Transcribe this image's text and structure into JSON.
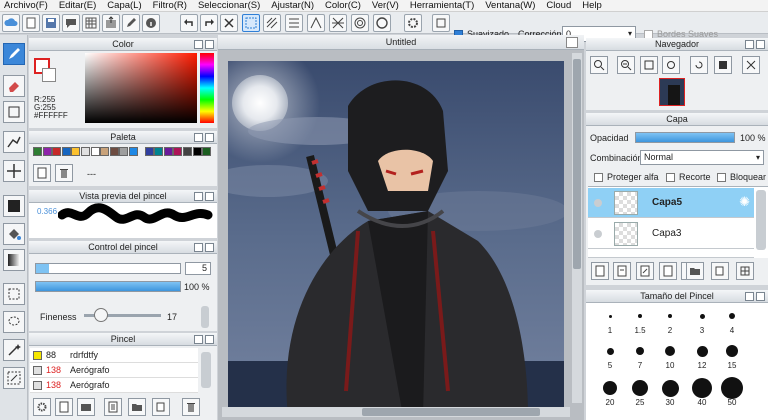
{
  "menu": [
    "Archivo(F)",
    "Editar(E)",
    "Capa(L)",
    "Filtro(R)",
    "Seleccionar(S)",
    "Ajustar(N)",
    "Color(C)",
    "Ver(V)",
    "Herramienta(T)",
    "Ventana(W)",
    "Cloud",
    "Help"
  ],
  "toolbar": {
    "suavizado_label": "Suavizado",
    "correccion_label": "Corrección",
    "correccion_value": "0",
    "bordes_label": "Bordes Suaves"
  },
  "color_panel": {
    "title": "Color",
    "r": "R:255",
    "g": "G:255",
    "hex": "#FFFFFF"
  },
  "palette_panel": {
    "title": "Paleta",
    "dashes": "---",
    "colors": [
      "#2e7d32",
      "#8e24aa",
      "#c62828",
      "#1565c0",
      "#fbc02d",
      "#e0e0e0",
      "#ffffff",
      "#c8a27a",
      "#6d4c41",
      "#9e9e9e",
      "#1e88e5",
      "#303f9f",
      "#00838f",
      "#6a1b9a",
      "#ad1457",
      "#424242",
      "#000000",
      "#1b5e20"
    ]
  },
  "brush_preview": {
    "title": "Vista previa del pincel",
    "size_value": "0.366"
  },
  "brush_control": {
    "title": "Control del pincel",
    "size": "5",
    "opacity": "100 %",
    "fineness_label": "Fineness",
    "fineness_value": "17"
  },
  "brush_list": {
    "title": "Pincel",
    "items": [
      {
        "size": "88",
        "name": "rdrfdtfy",
        "color": "#f5e600"
      },
      {
        "size": "138",
        "name": "Aerógrafo",
        "color": "#e0e0e0"
      },
      {
        "size": "138",
        "name": "Aerógrafo",
        "color": "#e0e0e0"
      }
    ]
  },
  "canvas": {
    "tab_title": "Untitled"
  },
  "navigator": {
    "title": "Navegador"
  },
  "layer_panel": {
    "title": "Capa",
    "opacity_label": "Opacidad",
    "opacity_value": "100 %",
    "blend_label": "Combinación",
    "blend_value": "Normal",
    "protect_label": "Proteger alfa",
    "clip_label": "Recorte",
    "lock_label": "Bloquear",
    "layers": [
      {
        "name": "Capa5",
        "selected": true
      },
      {
        "name": "Capa3",
        "selected": false
      }
    ]
  },
  "brush_size_panel": {
    "title": "Tamaño del Pincel",
    "sizes": [
      "1",
      "1.5",
      "2",
      "3",
      "4",
      "5",
      "7",
      "10",
      "12",
      "15",
      "20",
      "25",
      "30",
      "40",
      "50"
    ]
  }
}
